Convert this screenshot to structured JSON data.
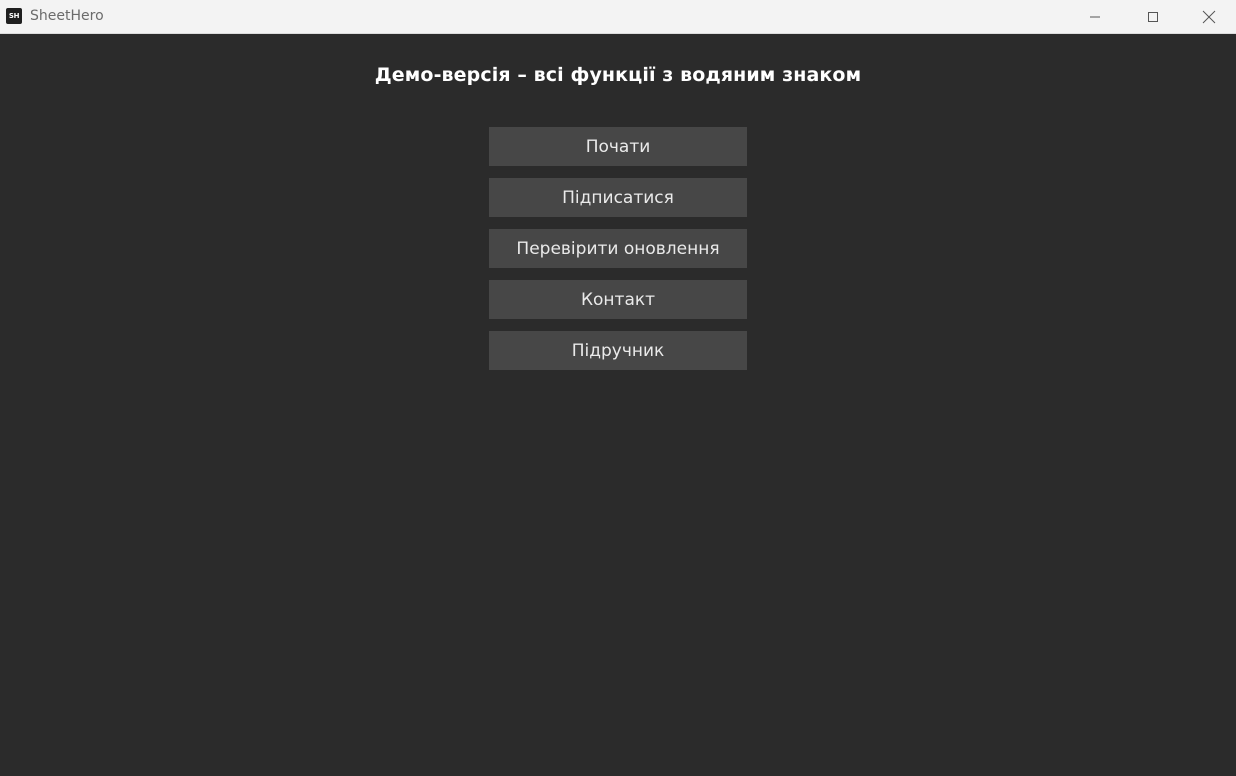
{
  "window": {
    "title": "SheetHero",
    "icon_text": "SH",
    "controls": {
      "minimize_icon": "minimize-icon",
      "maximize_icon": "maximize-icon",
      "close_icon": "close-icon"
    }
  },
  "main": {
    "heading": "Демо-версія – всі функції з водяним знаком",
    "buttons": [
      {
        "label": "Почати"
      },
      {
        "label": "Підписатися"
      },
      {
        "label": "Перевірити оновлення"
      },
      {
        "label": "Контакт"
      },
      {
        "label": "Підручник"
      }
    ]
  },
  "colors": {
    "background": "#2b2b2b",
    "titlebar": "#f3f3f3",
    "button": "#474747",
    "button_text": "#eaeaea",
    "heading_text": "#ffffff"
  }
}
